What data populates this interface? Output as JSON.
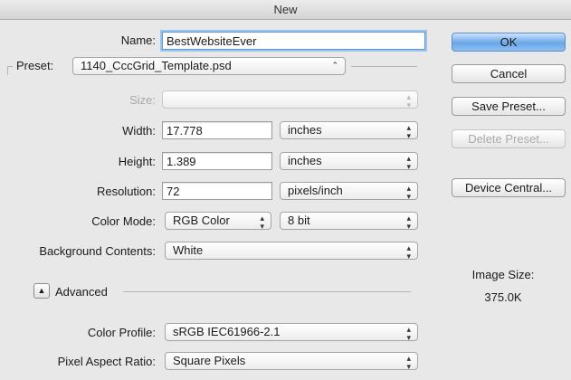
{
  "window": {
    "title": "New"
  },
  "form": {
    "name_label": "Name:",
    "name_value": "BestWebsiteEver",
    "preset_label": "Preset:",
    "preset_value": "1140_CccGrid_Template.psd",
    "size_label": "Size:",
    "size_value": "",
    "width_label": "Width:",
    "width_value": "17.778",
    "width_unit": "inches",
    "height_label": "Height:",
    "height_value": "1.389",
    "height_unit": "inches",
    "resolution_label": "Resolution:",
    "resolution_value": "72",
    "resolution_unit": "pixels/inch",
    "color_mode_label": "Color Mode:",
    "color_mode_value": "RGB Color",
    "bit_depth_value": "8 bit",
    "background_label": "Background Contents:",
    "background_value": "White",
    "advanced_label": "Advanced",
    "color_profile_label": "Color Profile:",
    "color_profile_value": "sRGB IEC61966-2.1",
    "pixel_aspect_label": "Pixel Aspect Ratio:",
    "pixel_aspect_value": "Square Pixels"
  },
  "buttons": {
    "ok": "OK",
    "cancel": "Cancel",
    "save_preset": "Save Preset...",
    "delete_preset": "Delete Preset...",
    "device_central": "Device Central..."
  },
  "image_size": {
    "label": "Image Size:",
    "value": "375.0K"
  },
  "icons": {
    "popup_arrows": "up-down-arrows-icon",
    "disclosure": "disclosure-triangle-up-icon"
  },
  "colors": {
    "default_button": "#6aa6e8",
    "focus_ring": "#9cc3eb"
  }
}
